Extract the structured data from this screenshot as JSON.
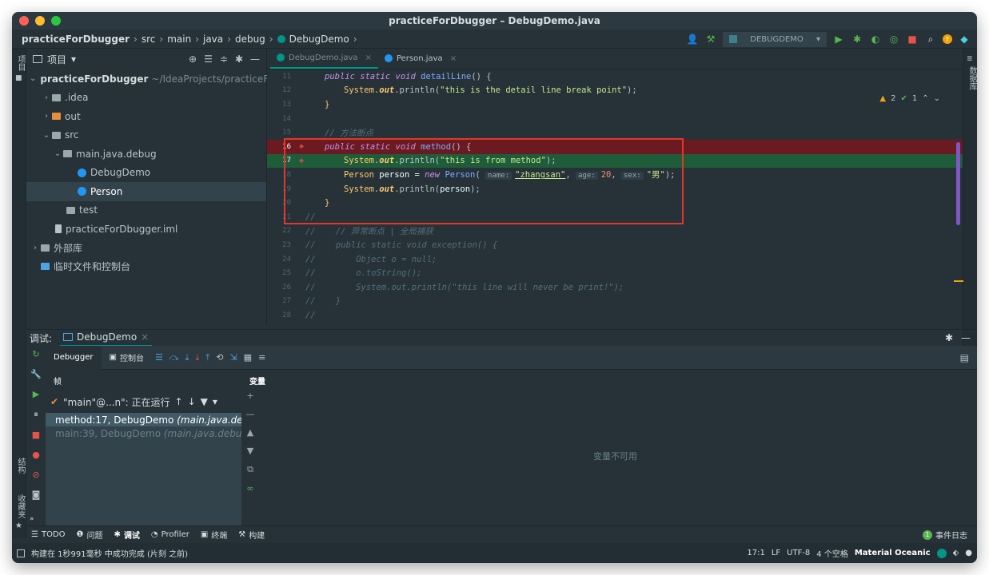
{
  "window": {
    "title": "practiceForDbugger – DebugDemo.java"
  },
  "breadcrumb": [
    "practiceForDbugger",
    "src",
    "main",
    "java",
    "debug",
    "DebugDemo"
  ],
  "toolbar": {
    "run_config": "DEBUGDEMO"
  },
  "left_strip": {
    "project_label": "项目",
    "structure_label": "结构",
    "favorites_label": "收藏夹"
  },
  "right_strip": {
    "database_label": "数据库"
  },
  "project": {
    "header": "项目",
    "tree": [
      {
        "label": "practiceForDbugger",
        "path": "~/IdeaProjects/practiceForDb"
      },
      {
        "label": ".idea"
      },
      {
        "label": "out"
      },
      {
        "label": "src"
      },
      {
        "label": "main.java.debug"
      },
      {
        "label": "DebugDemo"
      },
      {
        "label": "Person"
      },
      {
        "label": "test"
      },
      {
        "label": "practiceForDbugger.iml"
      },
      {
        "label": "外部库"
      },
      {
        "label": "临时文件和控制台"
      }
    ]
  },
  "editor": {
    "tabs": [
      {
        "label": "DebugDemo.java"
      },
      {
        "label": "Person.java"
      }
    ],
    "inspections": {
      "warnings": "2",
      "ok": "1"
    },
    "code": {
      "l11": {
        "num": "11",
        "kw": "public static void",
        "fn": "detailLine",
        "rest": "() {"
      },
      "l12": {
        "num": "12",
        "cls": "System",
        "out": "out",
        "dot": ".println(",
        "str": "\"this is the detail line break point\"",
        "end": ");"
      },
      "l13": {
        "num": "13",
        "text": "}"
      },
      "l14": {
        "num": "14"
      },
      "l15": {
        "num": "15",
        "cmt": "// 方法断点"
      },
      "l16": {
        "num": "16",
        "kw": "public static void",
        "fn": "method",
        "rest": "() {"
      },
      "l17": {
        "num": "17",
        "cls": "System",
        "out": "out",
        "dot": ".println(",
        "str": "\"this is from method\"",
        "end": ");"
      },
      "l18": {
        "num": "18",
        "type": "Person",
        "var": " person = ",
        "new": "new",
        "cls2": "Person",
        "open": "( ",
        "h1": "name:",
        "s1": "\"zhangsan\"",
        "c1": ", ",
        "h2": "age:",
        "n2": "20",
        "c2": ", ",
        "h3": "sex:",
        "s3": "\"男\"",
        "end": ");"
      },
      "l19": {
        "num": "19",
        "cls": "System",
        "out": "out",
        "dot": ".println(",
        "arg": "person",
        "end": ");"
      },
      "l20": {
        "num": "20",
        "text": "}"
      },
      "l21": {
        "num": "21",
        "cmt": "//"
      },
      "l22": {
        "num": "22",
        "cmt": "//    // 异常断点 | 全局捕获"
      },
      "l23": {
        "num": "23",
        "cmt": "//    public static void exception() {"
      },
      "l24": {
        "num": "24",
        "cmt": "//        Object o = null;"
      },
      "l25": {
        "num": "25",
        "cmt": "//        o.toString();"
      },
      "l26": {
        "num": "26",
        "cmt": "//        System.out.println(\"this line will never be print!\");"
      },
      "l27": {
        "num": "27",
        "cmt": "//    }"
      },
      "l28": {
        "num": "28",
        "cmt": "//"
      }
    }
  },
  "debug": {
    "label": "调试:",
    "session_tab": "DebugDemo",
    "debugger_tab": "Debugger",
    "console_tab": "控制台",
    "frames_header": "帧",
    "variables_header": "变量",
    "thread": "\"main\"@...n\": 正在运行",
    "frames": [
      {
        "method": "method:17, DebugDemo",
        "pkg": "(main.java.debug)"
      },
      {
        "method": "main:39, DebugDemo",
        "pkg": "(main.java.debug)"
      }
    ],
    "variables_empty": "变量不可用"
  },
  "bottom_tabs": [
    {
      "label": "TODO"
    },
    {
      "label": "问题"
    },
    {
      "label": "调试"
    },
    {
      "label": "Profiler"
    },
    {
      "label": "终端"
    },
    {
      "label": "构建"
    }
  ],
  "event_log": {
    "count": "1",
    "label": "事件日志"
  },
  "status": {
    "message": "构建在 1秒991毫秒 中成功完成 (片刻 之前)",
    "position": "17:1",
    "line_sep": "LF",
    "encoding": "UTF-8",
    "indent": "4 个空格",
    "theme": "Material Oceanic"
  },
  "colors": {
    "accent": "#009688",
    "breakpoint": "#e5534b",
    "background": "#263238"
  }
}
